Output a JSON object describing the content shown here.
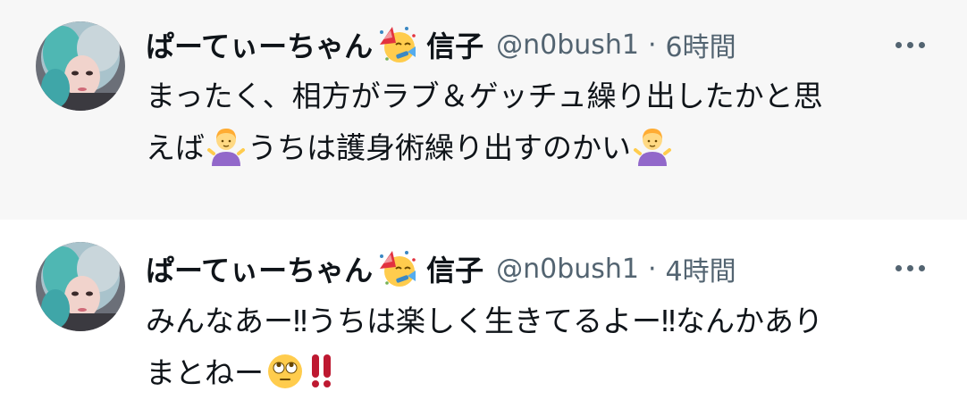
{
  "tweets": [
    {
      "display_name": "ぱーてぃーちゃん",
      "name_emoji": "party-face-icon",
      "name_suffix": "信子",
      "handle": "@n0bush1",
      "separator": "·",
      "timestamp": "6時間",
      "text_line1": "まったく、相方がラブ＆ゲッチュ繰り出したかと思",
      "text_line2_a": "えば",
      "text_line2_emoji": "person-shrugging-icon",
      "text_line2_b": "うちは護身術繰り出すのかい",
      "text_line2_emoji_end": "person-shrugging-icon"
    },
    {
      "display_name": "ぱーてぃーちゃん",
      "name_emoji": "party-face-icon",
      "name_suffix": "信子",
      "handle": "@n0bush1",
      "separator": "·",
      "timestamp": "4時間",
      "text_line1": "みんなあー‼うちは楽しく生きてるよー‼なんかあり",
      "text_line2_a": "まとねー",
      "text_line2_emoji": "face-with-rolling-eyes-icon",
      "text_line2_emoji_end": "double-exclamation-icon"
    }
  ],
  "colors": {
    "selected_background": "#f7f7f7",
    "thread_line": "#cfd9de",
    "primary_text": "#0f1419",
    "secondary_text": "#536471"
  }
}
